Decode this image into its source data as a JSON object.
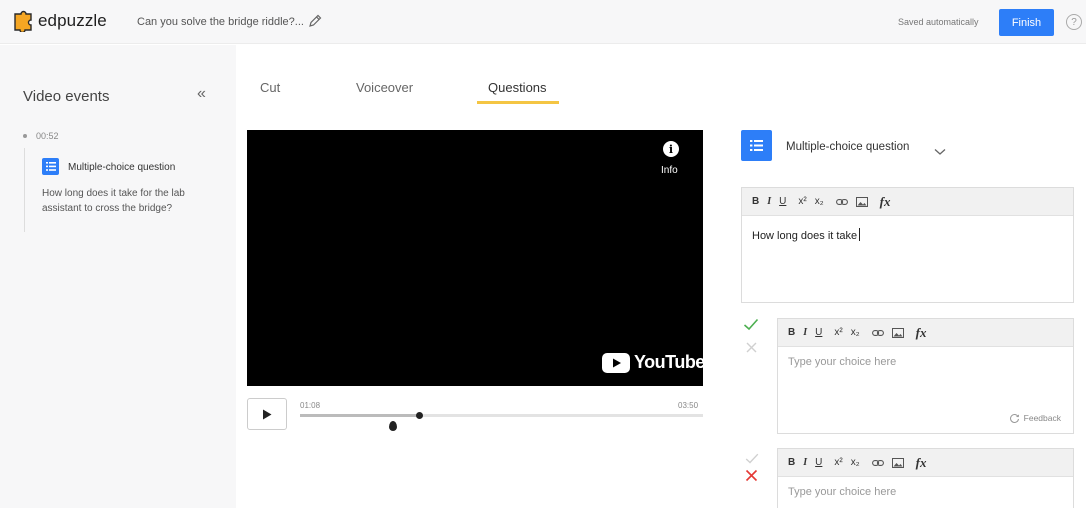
{
  "header": {
    "brand": "edpuzzle",
    "video_title": "Can you solve the bridge riddle?...",
    "saved_status": "Saved automatically",
    "finish_label": "Finish",
    "help_symbol": "?"
  },
  "sidebar": {
    "title": "Video events",
    "collapse_symbol": "«",
    "events": [
      {
        "time": "00:52",
        "type": "Multiple-choice question",
        "text": "How long does it take for the lab assistant to cross the bridge?"
      }
    ]
  },
  "tabs": [
    {
      "label": "Cut",
      "active": false
    },
    {
      "label": "Voiceover",
      "active": false
    },
    {
      "label": "Questions",
      "active": true
    }
  ],
  "player": {
    "info_label": "Info",
    "youtube_label": "YouTube",
    "current_time": "01:08",
    "total_time": "03:50",
    "progress_fraction": 0.296
  },
  "question": {
    "type_label": "Multiple-choice question",
    "text": "How long does it take",
    "toolbar": {
      "bold": "B",
      "italic": "I",
      "underline": "U",
      "superscript": "x²",
      "subscript": "x₂",
      "formula": "fx"
    },
    "choices": [
      {
        "placeholder": "Type your choice here",
        "correct": true,
        "feedback_label": "Feedback"
      },
      {
        "placeholder": "Type your choice here",
        "correct": false
      }
    ]
  },
  "colors": {
    "accent_blue": "#2d7ef8",
    "tab_underline": "#f4c543",
    "correct_green": "#4caf50",
    "wrong_red": "#e53935"
  }
}
